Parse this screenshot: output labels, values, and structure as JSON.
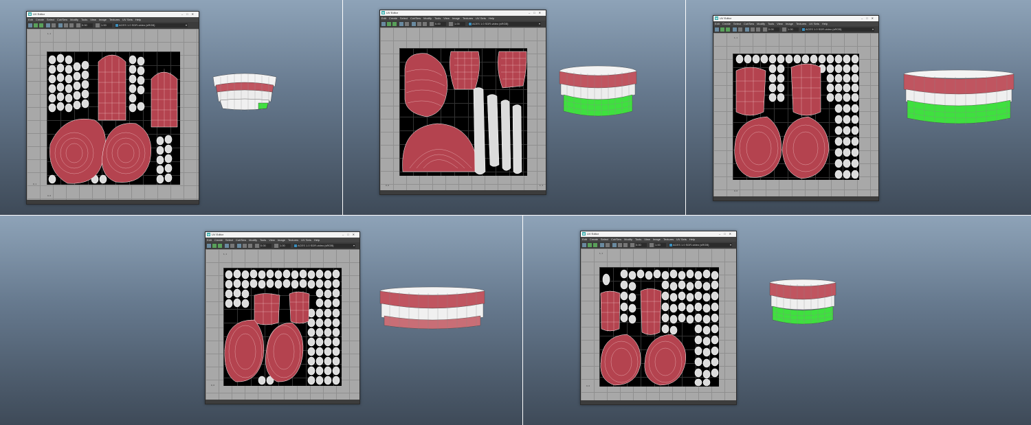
{
  "window": {
    "title": "UV Editor",
    "menus": [
      "Edit",
      "Create",
      "Select",
      "Cut/Sew",
      "Modify",
      "Tools",
      "View",
      "Image",
      "Textures",
      "UV Sets",
      "Help"
    ],
    "field_a": "0.00",
    "field_b": "1.00",
    "colorspace": "ACES 1.0 SDR-video (sRGB)",
    "coord_top": "1, 1",
    "coord_left": "0, 1",
    "coord_bottom": "0, 0",
    "coord_right": "1, 1"
  },
  "panels": [
    {
      "name": "Top left: UV Editor and shell mesh"
    },
    {
      "name": "Top middle: UV Editor with strips"
    },
    {
      "name": "Top right: UV Editor with teeth and gums"
    },
    {
      "name": "Bottom left: UV Editor"
    },
    {
      "name": "Bottom right: UV Editor"
    }
  ],
  "colors": {
    "gum": "#b4434f",
    "gum_light": "#d08c92",
    "tooth": "#e8e8e8",
    "wire_white": "#ffffff",
    "selected_green": "#3fe03f",
    "uv_bg": "#000000",
    "viewport_grey": "#a8a8a8"
  }
}
